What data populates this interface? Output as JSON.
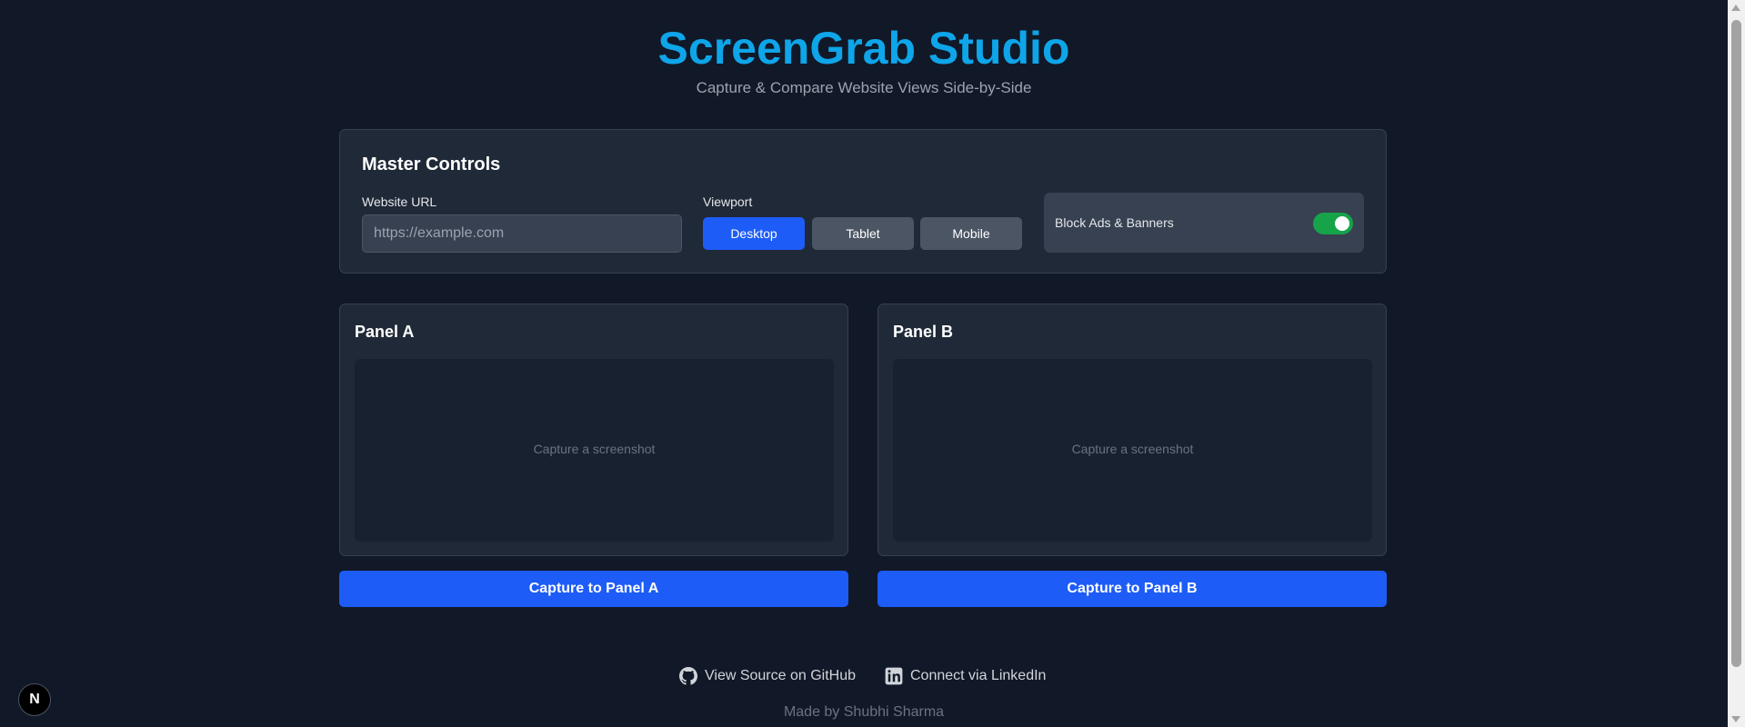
{
  "header": {
    "title": "ScreenGrab Studio",
    "subtitle": "Capture & Compare Website Views Side-by-Side"
  },
  "master": {
    "title": "Master Controls",
    "url_label": "Website URL",
    "url_placeholder": "https://example.com",
    "url_value": "",
    "viewport_label": "Viewport",
    "viewports": [
      "Desktop",
      "Tablet",
      "Mobile"
    ],
    "viewport_selected": "Desktop",
    "block_ads_label": "Block Ads & Banners",
    "block_ads_enabled": true
  },
  "panels": [
    {
      "title": "Panel A",
      "placeholder": "Capture a screenshot",
      "button": "Capture to Panel A"
    },
    {
      "title": "Panel B",
      "placeholder": "Capture a screenshot",
      "button": "Capture to Panel B"
    }
  ],
  "footer": {
    "github_label": "View Source on GitHub",
    "linkedin_label": "Connect via LinkedIn",
    "made_by": "Made by Shubhi Sharma"
  },
  "badge": {
    "letter": "N"
  },
  "colors": {
    "accent": "#0ea5e9",
    "primary_button": "#1d5cf7",
    "toggle_on": "#16a34a",
    "background": "#111827"
  }
}
